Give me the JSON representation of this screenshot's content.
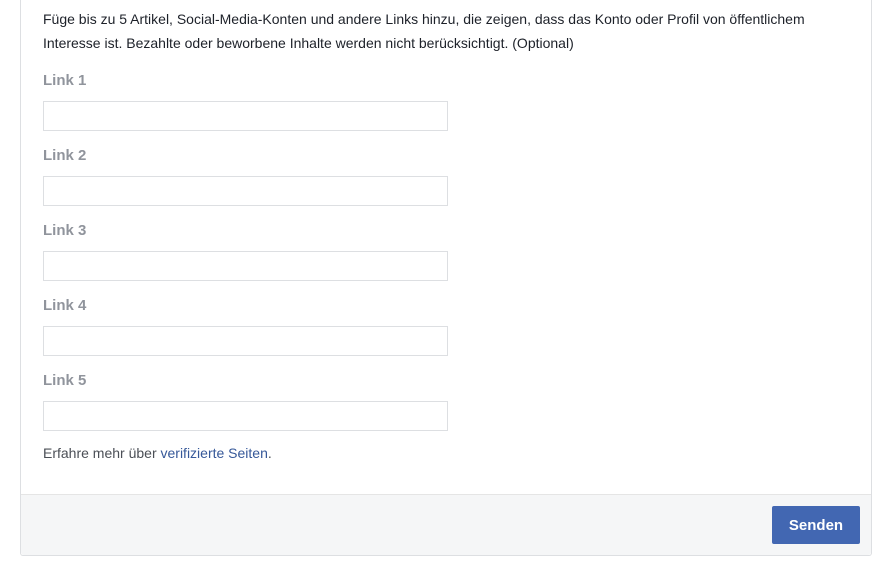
{
  "form": {
    "description": "Füge bis zu 5 Artikel, Social-Media-Konten und andere Links hinzu, die zeigen, dass das Konto oder Profil von öffentlichem Interesse ist. Bezahlte oder beworbene Inhalte werden nicht berücksichtigt. (Optional)",
    "links": [
      {
        "label": "Link 1",
        "value": ""
      },
      {
        "label": "Link 2",
        "value": ""
      },
      {
        "label": "Link 3",
        "value": ""
      },
      {
        "label": "Link 4",
        "value": ""
      },
      {
        "label": "Link 5",
        "value": ""
      }
    ],
    "learn_more_prefix": "Erfahre mehr über ",
    "learn_more_link": "verifizierte Seiten",
    "learn_more_suffix": "."
  },
  "footer": {
    "send_label": "Senden"
  },
  "colors": {
    "accent": "#4267b2",
    "link": "#365899",
    "label": "#90949c",
    "footer_bg": "#f5f6f7"
  }
}
